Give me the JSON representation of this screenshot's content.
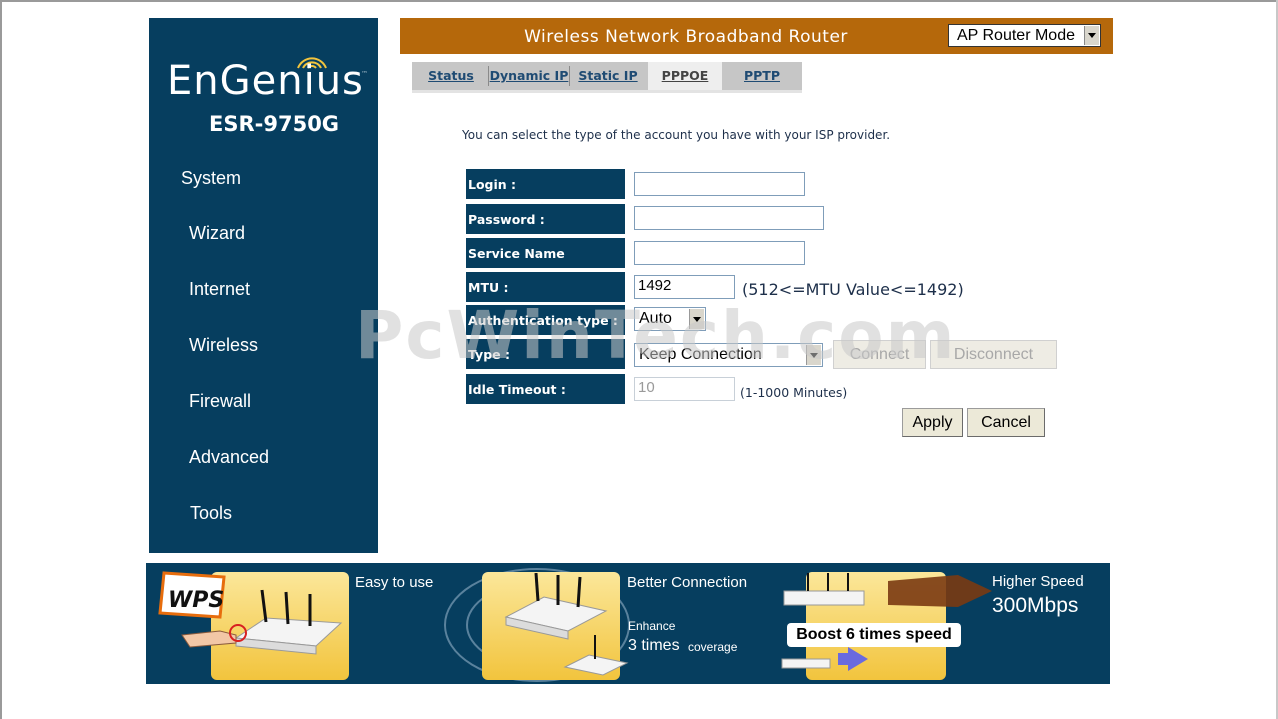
{
  "brand": {
    "logo_text": "EnGenius",
    "trademark": "™",
    "model": "ESR-9750G"
  },
  "sidebar": {
    "items": [
      {
        "label": "System"
      },
      {
        "label": "Wizard"
      },
      {
        "label": "Internet"
      },
      {
        "label": "Wireless"
      },
      {
        "label": "Firewall"
      },
      {
        "label": "Advanced"
      },
      {
        "label": "Tools"
      }
    ]
  },
  "header": {
    "title": "Wireless Network Broadband Router",
    "mode_select": "AP Router Mode"
  },
  "tabs": [
    {
      "label": "Status",
      "active": false
    },
    {
      "label": "Dynamic IP",
      "active": false
    },
    {
      "label": "Static IP",
      "active": false
    },
    {
      "label": "PPPOE",
      "active": true
    },
    {
      "label": "PPTP",
      "active": false
    }
  ],
  "intro": "You can select the type of the account you have with your ISP provider.",
  "form": {
    "login_label": "Login :",
    "login_value": "",
    "password_label": "Password :",
    "password_value": "",
    "service_label": "Service Name",
    "service_value": "",
    "mtu_label": "MTU :",
    "mtu_value": "1492",
    "mtu_hint": "(512<=MTU Value<=1492)",
    "auth_label": "Authentication type :",
    "auth_value": "Auto",
    "type_label": "Type :",
    "type_value": "Keep Connection",
    "connect_label": "Connect",
    "disconnect_label": "Disconnect",
    "idle_label": "Idle Timeout :",
    "idle_value": "10",
    "idle_hint": "(1-1000 Minutes)"
  },
  "buttons": {
    "apply": "Apply",
    "cancel": "Cancel"
  },
  "watermark": "PcWinTech.com",
  "banner": {
    "wps_badge": "WPS",
    "easy": "Easy to use",
    "better": "Better Connection",
    "enhance": "Enhance",
    "times": "3 times",
    "coverage": "coverage",
    "boost": "Boost 6 times speed",
    "higher": "Higher Speed",
    "speed": "300Mbps"
  },
  "colors": {
    "navy": "#063e5f",
    "header_orange": "#b5680b",
    "panel_gold": "#f2c43d"
  }
}
